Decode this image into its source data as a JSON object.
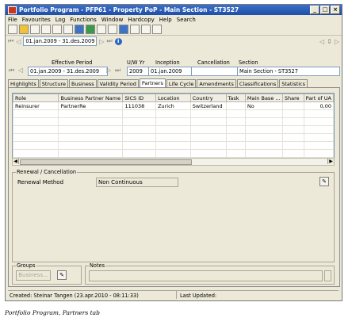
{
  "window": {
    "title": "Portfolio Program - PFP61 - Property PoP - Main Section - ST3527"
  },
  "menu": [
    "File",
    "Favourites",
    "Log",
    "Functions",
    "Window",
    "Hardcopy",
    "Help",
    "Search"
  ],
  "nav": {
    "period": "01.jan.2009 - 31.des.2009"
  },
  "header": {
    "labels": {
      "effective_period": "Effective Period",
      "uw_yr": "U/W Yr",
      "inception": "Inception",
      "cancellation": "Cancellation",
      "section": "Section"
    },
    "values": {
      "effective_period": "01.jan.2009 - 31.des.2009",
      "uw_yr": "2009",
      "inception": "01.jan.2009",
      "cancellation": "",
      "section": "Main Section - ST3527"
    }
  },
  "tabs": [
    "Highlights",
    "Structure",
    "Business",
    "Validity Period",
    "Partners",
    "Life Cycle",
    "Amendments",
    "Classifications",
    "Statistics"
  ],
  "active_tab": "Partners",
  "grid": {
    "columns": [
      "Role",
      "Business Partner Name",
      "SICS ID",
      "Location",
      "Country",
      "Task",
      "Main Base ...",
      "Share",
      "Part of UA"
    ],
    "rows": [
      [
        "Reinsurer",
        "PartnerRe",
        "111038",
        "Zurich",
        "Switzerland",
        "",
        "No",
        "",
        "0,00"
      ]
    ]
  },
  "renewal": {
    "group_label": "Renewal / Cancellation",
    "method_label": "Renewal Method",
    "method_value": "Non Continuous"
  },
  "groups": {
    "label": "Groups",
    "button": "Business..."
  },
  "notes": {
    "label": "Notes"
  },
  "status": {
    "created": "Created: Steinar Tangen (23.apr.2010 - 08:11:33)",
    "last_updated": "Last Updated:"
  },
  "caption": "Portfolio Program, Partners tab"
}
